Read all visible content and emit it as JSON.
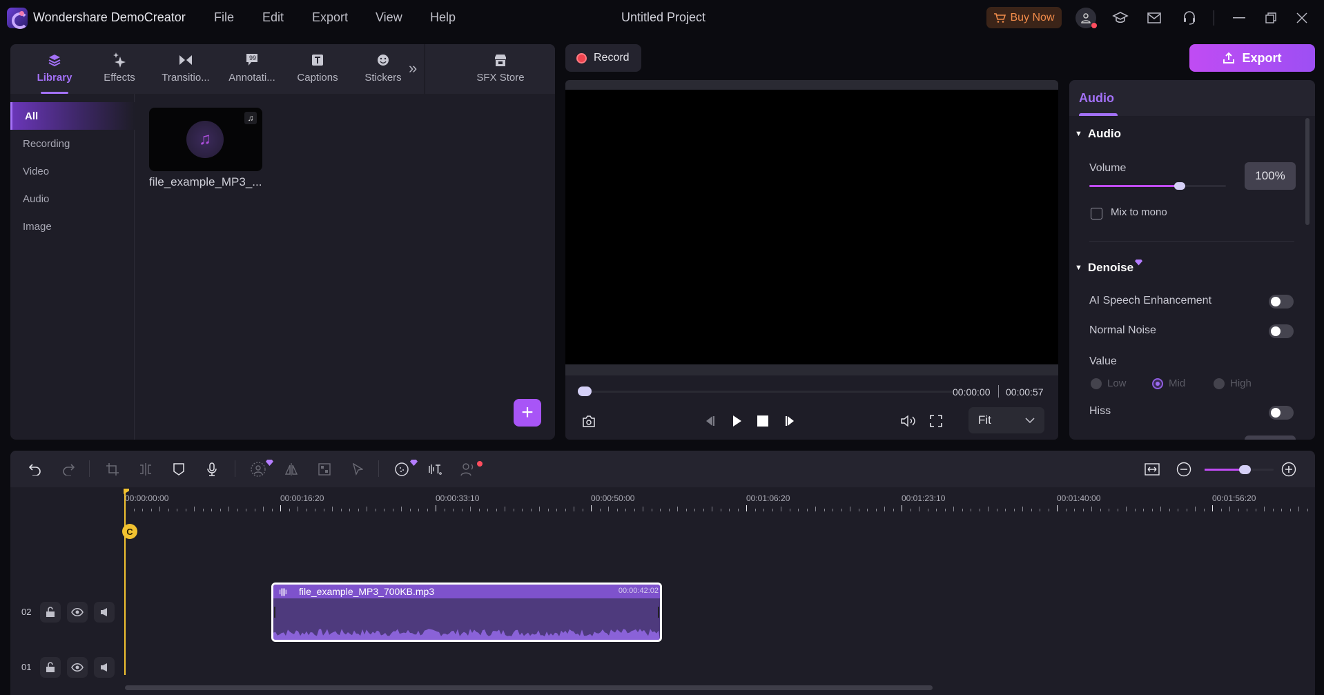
{
  "app": {
    "title": "Wondershare DemoCreator",
    "project_title": "Untitled Project",
    "menu": [
      "File",
      "Edit",
      "Export",
      "View",
      "Help"
    ],
    "buy_now": "Buy Now",
    "icons": [
      "account-icon",
      "academy-icon",
      "mail-icon",
      "support-headset-icon",
      "minimize-icon",
      "restore-icon",
      "close-icon"
    ]
  },
  "library": {
    "tabs": [
      {
        "label": "Library",
        "icon": "layers-icon",
        "active": true
      },
      {
        "label": "Effects",
        "icon": "sparkle-icon"
      },
      {
        "label": "Transitio...",
        "icon": "transition-icon"
      },
      {
        "label": "Annotati...",
        "icon": "annotation-icon"
      },
      {
        "label": "Captions",
        "icon": "captions-icon"
      },
      {
        "label": "Stickers",
        "icon": "sticker-icon"
      }
    ],
    "more_label": "»",
    "sfx_store": "SFX Store",
    "sidebar": [
      "All",
      "Recording",
      "Video",
      "Audio",
      "Image"
    ],
    "sidebar_active": "All",
    "media": [
      {
        "name": "file_example_MP3_...",
        "type": "audio"
      }
    ]
  },
  "record": {
    "label": "Record"
  },
  "export": {
    "label": "Export"
  },
  "preview": {
    "current_time": "00:00:00",
    "total_time": "00:00:57",
    "progress": 0,
    "fit_label": "Fit"
  },
  "properties": {
    "tab": "Audio",
    "audio_section": "Audio",
    "volume_label": "Volume",
    "volume_value": "100%",
    "volume_fraction": 0.66,
    "mix_to_mono": "Mix to mono",
    "mix_to_mono_checked": false,
    "denoise_section": "Denoise",
    "ai_speech": "AI Speech Enhancement",
    "ai_speech_on": false,
    "normal_noise": "Normal Noise",
    "normal_noise_on": false,
    "value_label": "Value",
    "value_options": [
      "Low",
      "Mid",
      "High"
    ],
    "value_selected": "Mid",
    "hiss": "Hiss",
    "hiss_on": false
  },
  "timeline": {
    "ruler_labels": [
      "00:00:00:00",
      "00:00:16:20",
      "00:00:33:10",
      "00:00:50:00",
      "00:01:06:20",
      "00:01:23:10",
      "00:01:40:00",
      "00:01:56:20"
    ],
    "playhead_tag": "C",
    "zoom_fraction": 0.58,
    "tracks": [
      {
        "number": "02"
      },
      {
        "number": "01"
      }
    ],
    "clip": {
      "name": "file_example_MP3_700KB.mp3",
      "duration": "00:00:42:02",
      "track": "02"
    }
  }
}
